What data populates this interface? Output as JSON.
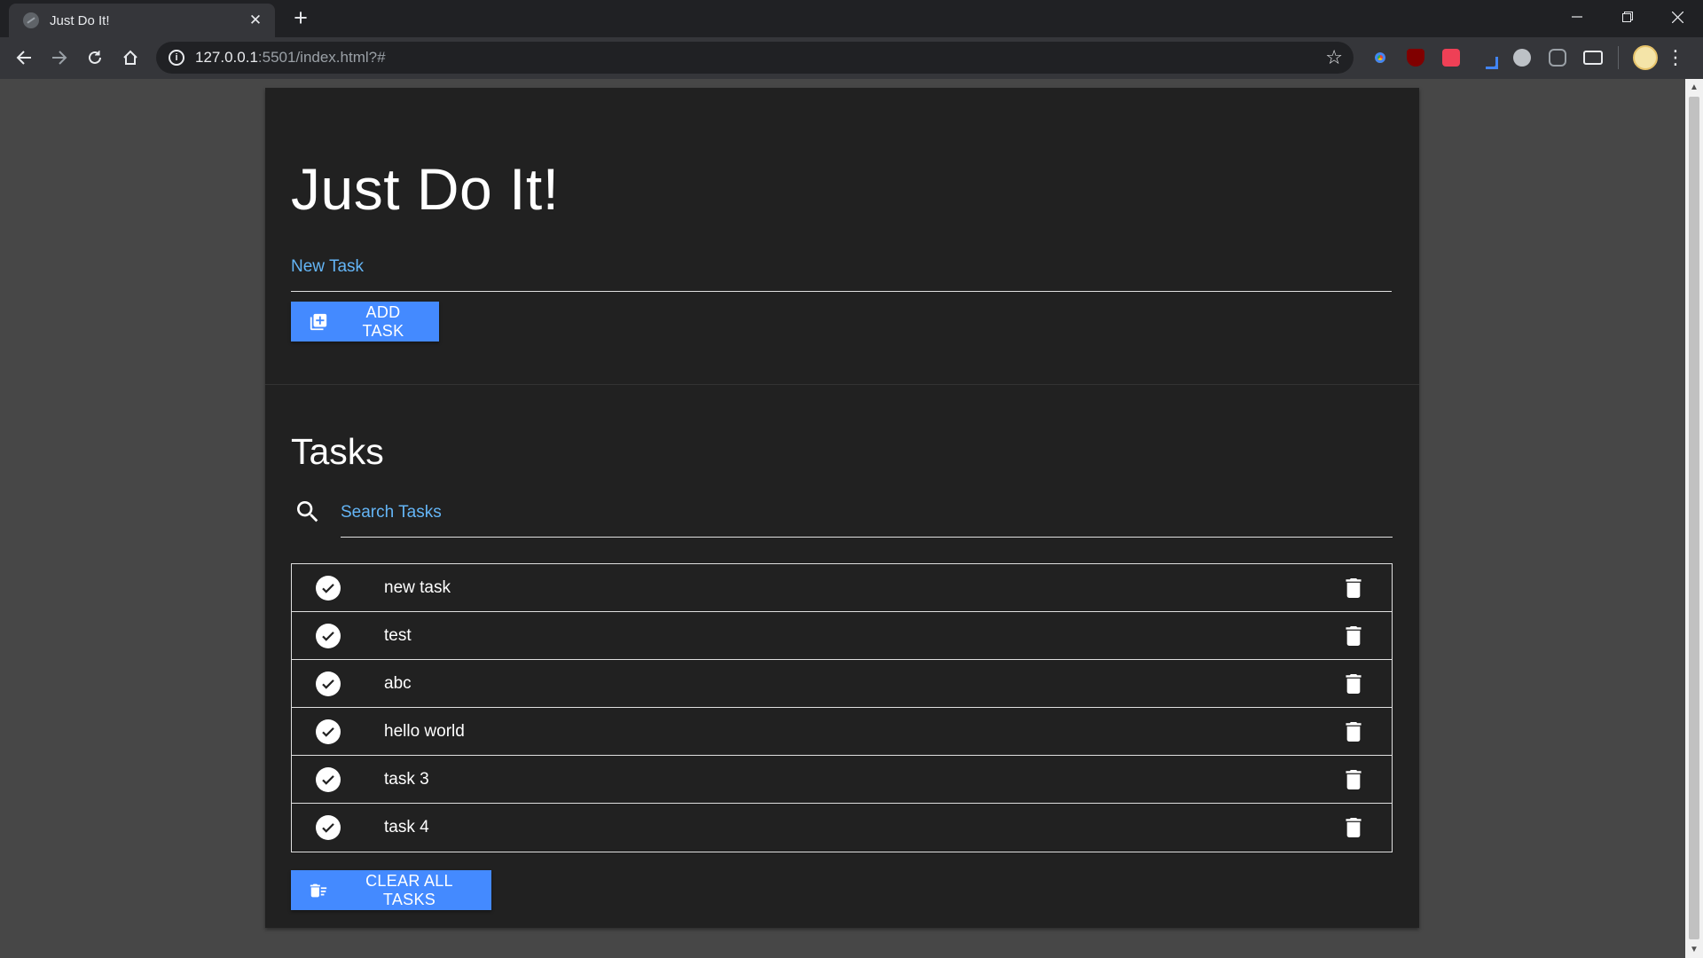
{
  "browser": {
    "tab_title": "Just Do It!",
    "tab_close": "✕",
    "new_tab": "+",
    "url_host": "127.0.0.1",
    "url_rest": ":5501/index.html?#"
  },
  "app": {
    "title": "Just Do It!",
    "new_task_label": "New Task",
    "add_button": "ADD TASK",
    "tasks_heading": "Tasks",
    "search_label": "Search Tasks",
    "clear_button": "CLEAR ALL TASKS"
  },
  "tasks": [
    {
      "text": "new task"
    },
    {
      "text": "test"
    },
    {
      "text": "abc"
    },
    {
      "text": "hello world"
    },
    {
      "text": "task 3"
    },
    {
      "text": "task 4"
    }
  ],
  "colors": {
    "accent": "#448aff",
    "label": "#64b5f6",
    "card": "#212121",
    "page": "#474747"
  }
}
